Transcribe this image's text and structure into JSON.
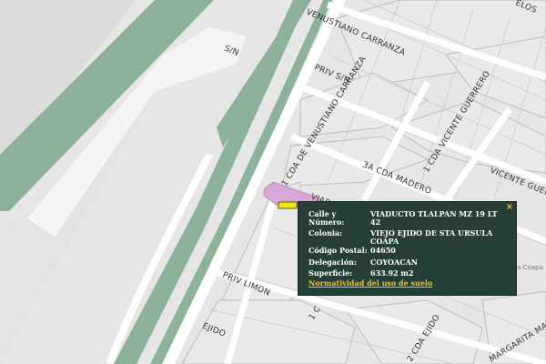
{
  "map": {
    "streets": {
      "venustiano_carranza": "VENUSTIANO CARRANZA",
      "priv_sn": "PRIV S/N",
      "sn": "S/N",
      "cda_venustiano_carranza": "1 CDA DE VENUSTIANO CARRANZA",
      "cda_madero": "3A CDA MADERO",
      "cda_vicente_guerrero": "1 CDA VICENTE GUERRERO",
      "vicente_guerrero": "VICENTE GUERRERO",
      "viaducto_tlalpan": "VIADUCTO TLALPAN",
      "priv_limon": "PRIV LIMON",
      "ejido": "EJIDO",
      "cda_ejido": "2 CDA EJIDO",
      "margarita_maza": "MARGARITA MAZA D",
      "cda_partial": "1 C",
      "muelos_partial": "ELOS"
    },
    "ghost_colonia": "Viejo Ejido de Santa Ursula Coapa",
    "colors": {
      "park_green": "#8cb29a",
      "road_white": "#ffffff",
      "parcel_pink": "#d9a8d6",
      "marker_yellow": "#f0ea00"
    }
  },
  "popup": {
    "close_label": "×",
    "rows": [
      {
        "label": "Calle y Número:",
        "value": "VIADUCTO TLALPAN MZ 19 LT 42"
      },
      {
        "label": "Colonia:",
        "value": "VIEJO EJIDO DE STA URSULA COAPA"
      },
      {
        "label": "Código Postal:",
        "value": "04650"
      },
      {
        "label": "Delegación:",
        "value": "COYOACAN"
      },
      {
        "label": "Superficie:",
        "value": "633.92 m2"
      }
    ],
    "link_label": "Normatividad del uso de suelo"
  }
}
